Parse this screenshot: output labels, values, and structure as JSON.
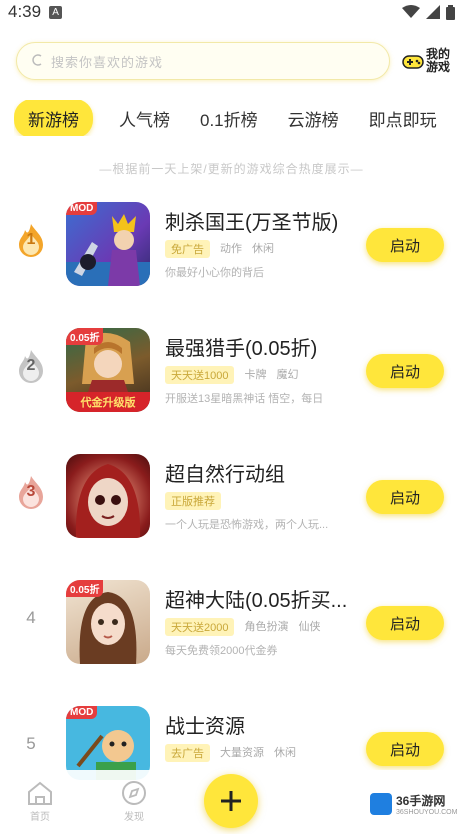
{
  "status_bar": {
    "time": "4:39",
    "badge": "A"
  },
  "search": {
    "placeholder": "搜索你喜欢的游戏",
    "my_games_label_1": "我的",
    "my_games_label_2": "游戏"
  },
  "tabs": [
    {
      "label": "新游榜",
      "active": true
    },
    {
      "label": "人气榜",
      "active": false
    },
    {
      "label": "0.1折榜",
      "active": false
    },
    {
      "label": "云游榜",
      "active": false
    },
    {
      "label": "即点即玩",
      "active": false
    }
  ],
  "subtitle": "—根据前一天上架/更新的游戏综合热度展示—",
  "games": [
    {
      "rank": "1",
      "title": "刺杀国王(万圣节版)",
      "badge": "MOD",
      "tags": [
        "免广告",
        "动作",
        "休闲"
      ],
      "desc": "你最好小心你的背后",
      "button": "启动"
    },
    {
      "rank": "2",
      "title": "最强猎手(0.05折)",
      "badge": "0.05折",
      "band": "代金升级版",
      "tags": [
        "天天送1000",
        "卡牌",
        "魔幻"
      ],
      "desc": "开服送13星暗黑神话 悟空，每日",
      "button": "启动"
    },
    {
      "rank": "3",
      "title": "超自然行动组",
      "tags": [
        "正版推荐"
      ],
      "desc": "一个人玩是恐怖游戏，两个人玩...",
      "button": "启动"
    },
    {
      "rank": "4",
      "title": "超神大陆(0.05折买...",
      "badge": "0.05折",
      "tags": [
        "天天送2000",
        "角色扮演",
        "仙侠"
      ],
      "desc": "每天免费领2000代金券",
      "button": "启动"
    },
    {
      "rank": "5",
      "title": "战士资源",
      "badge": "MOD",
      "tags": [
        "去广告",
        "大量资源",
        "休闲"
      ],
      "desc": "",
      "button": "启动"
    }
  ],
  "bottom_nav": {
    "home": "首页",
    "discover": "发现",
    "watermark": "36手游网",
    "watermark_sub": "36SHOUYOU.COM"
  },
  "colors": {
    "accent": "#ffe63b",
    "tag_highlight_bg": "#fff3b8"
  }
}
